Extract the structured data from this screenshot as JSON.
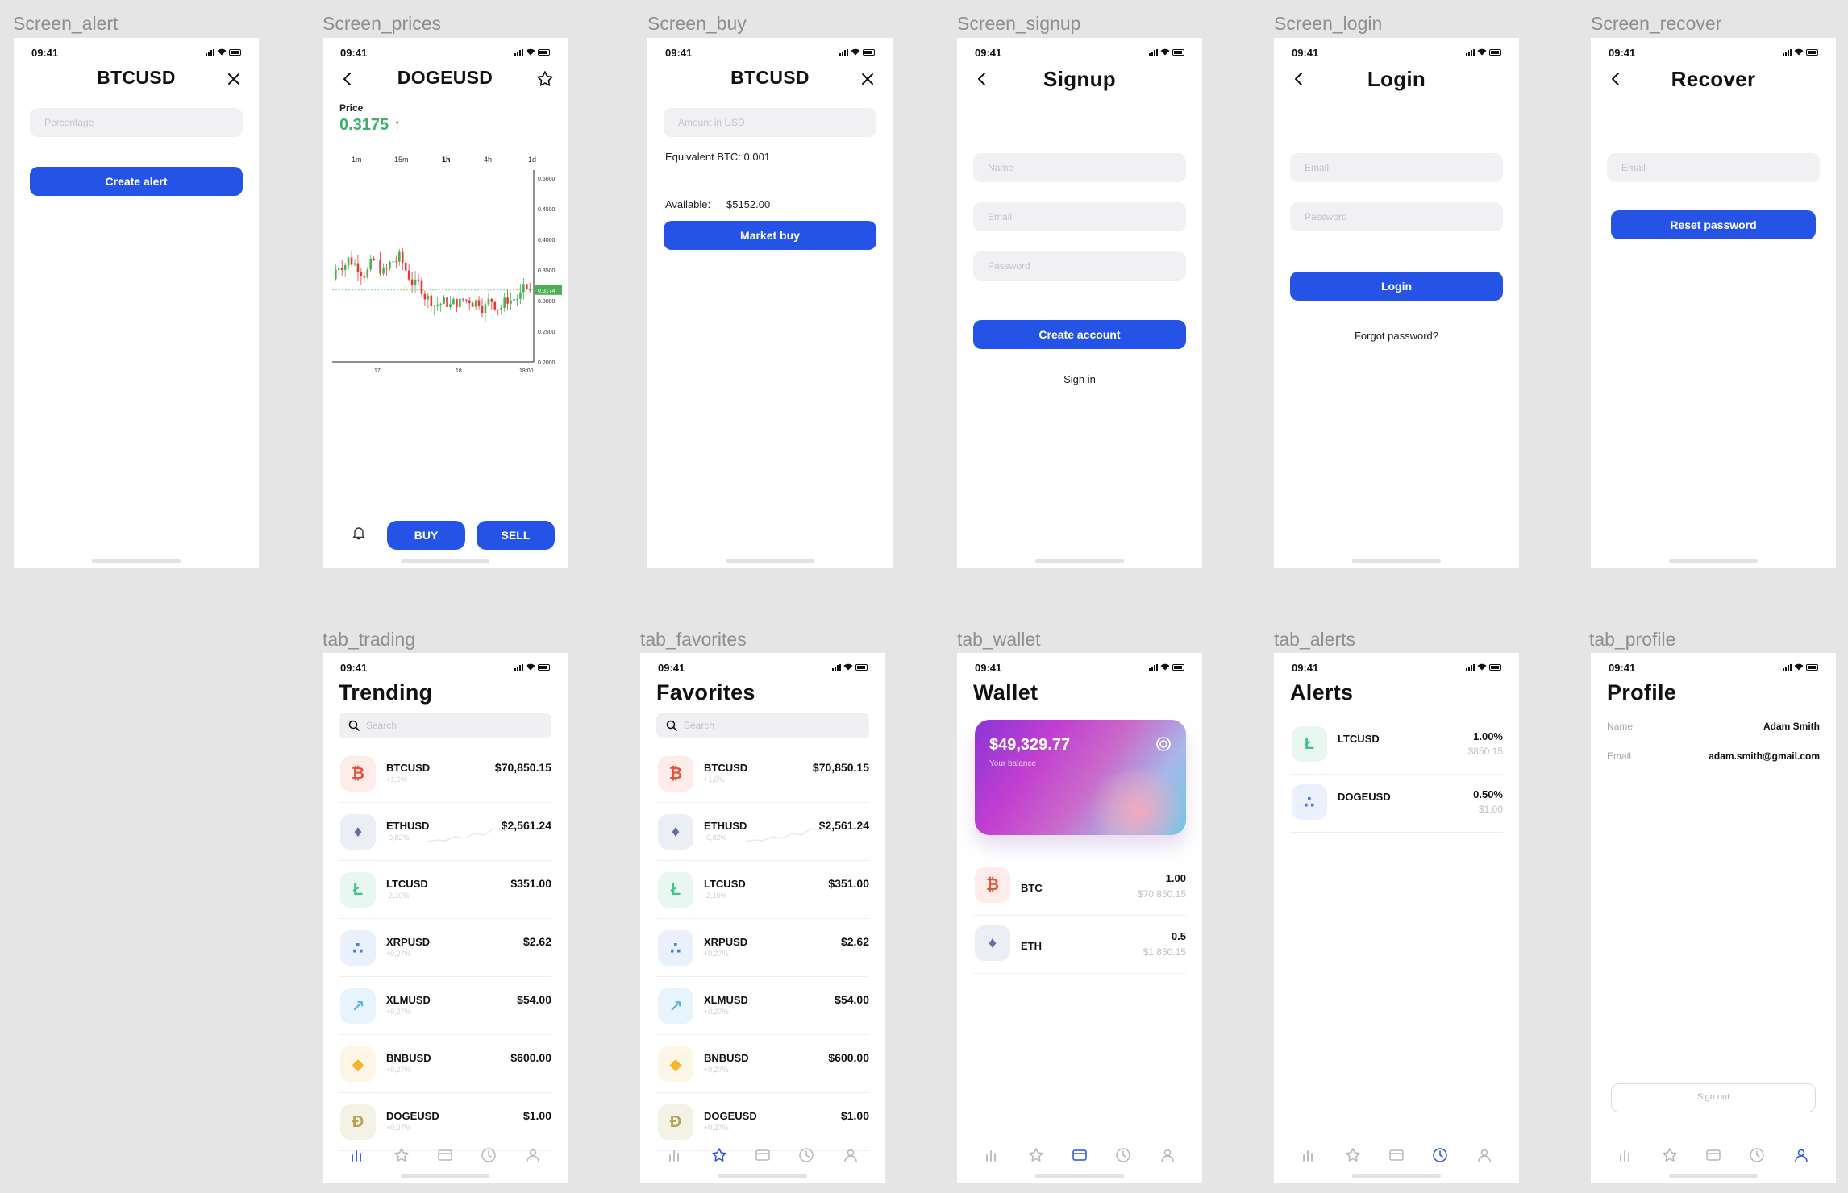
{
  "status_time": "09:41",
  "frame_labels": {
    "alert": "Screen_alert",
    "prices": "Screen_prices",
    "buy": "Screen_buy",
    "signup": "Screen_signup",
    "login": "Screen_login",
    "recover": "Screen_recover",
    "trading": "tab_trading",
    "favorites": "tab_favorites",
    "wallet": "tab_wallet",
    "alerts": "tab_alerts",
    "profile": "tab_profile"
  },
  "alert": {
    "title": "BTCUSD",
    "percentage_placeholder": "Percentage",
    "create_label": "Create alert"
  },
  "prices": {
    "title": "DOGEUSD",
    "price_label": "Price",
    "price_value": "0.3175 ↑",
    "timeframes": [
      "1m",
      "15m",
      "1h",
      "4h",
      "1d"
    ],
    "buy_label": "BUY",
    "sell_label": "SELL",
    "chart": {
      "y_ticks": [
        "0.5000",
        "0.4500",
        "0.4000",
        "0.3500",
        "0.3000",
        "0.2500",
        "0.2000"
      ],
      "x_ticks": [
        "17",
        "18",
        "18:00"
      ],
      "current_tag": "0.3174",
      "up_color": "#4caf50",
      "down_color": "#e53935"
    }
  },
  "buy": {
    "title": "BTCUSD",
    "amount_placeholder": "Amount in USD",
    "equivalent": "Equivalent BTC: 0.001",
    "available_label": "Available:",
    "available_value": "$5152.00",
    "market_buy_label": "Market buy"
  },
  "signup": {
    "title": "Signup",
    "name_placeholder": "Name",
    "email_placeholder": "Email",
    "password_placeholder": "Password",
    "create_label": "Create account",
    "signin_link": "Sign in"
  },
  "login": {
    "title": "Login",
    "email_placeholder": "Email",
    "password_placeholder": "Password",
    "login_label": "Login",
    "forgot_link": "Forgot password?"
  },
  "recover": {
    "title": "Recover",
    "email_placeholder": "Email",
    "reset_label": "Reset password"
  },
  "search_placeholder": "Search",
  "coins": [
    {
      "name": "BTCUSD",
      "change": "+1,6%",
      "price": "$70,850.15",
      "icon": "bitcoin-icon",
      "bg": "#fdece9",
      "fg": "#e0543a"
    },
    {
      "name": "ETHUSD",
      "change": "-0,82%",
      "price": "$2,561.24",
      "icon": "ethereum-icon",
      "bg": "#eceef6",
      "fg": "#5f6fa8"
    },
    {
      "name": "LTCUSD",
      "change": "-2,10%",
      "price": "$351.00",
      "icon": "litecoin-icon",
      "bg": "#e8f8f1",
      "fg": "#3fc48a"
    },
    {
      "name": "XRPUSD",
      "change": "+0,27%",
      "price": "$2.62",
      "icon": "xrp-icon",
      "bg": "#eaf0fc",
      "fg": "#4a78e8"
    },
    {
      "name": "XLMUSD",
      "change": "+0,27%",
      "price": "$54.00",
      "icon": "stellar-icon",
      "bg": "#e8f4fd",
      "fg": "#5cb3ee"
    },
    {
      "name": "BNBUSD",
      "change": "+0,27%",
      "price": "$600.00",
      "icon": "binance-icon",
      "bg": "#fdf6e7",
      "fg": "#f0b72f"
    },
    {
      "name": "DOGEUSD",
      "change": "+0,27%",
      "price": "$1.00",
      "icon": "dogecoin-icon",
      "bg": "#f4f1e6",
      "fg": "#b9a453"
    }
  ],
  "trading": {
    "title": "Trending"
  },
  "favorites": {
    "title": "Favorites"
  },
  "wallet": {
    "title": "Wallet",
    "balance": "$49,329.77",
    "balance_label": "Your balance",
    "assets": [
      {
        "name": "BTC",
        "amount": "1.00",
        "value": "$70,850.15",
        "icon": "bitcoin-icon"
      },
      {
        "name": "ETH",
        "amount": "0.5",
        "value": "$1,850.15",
        "icon": "ethereum-icon"
      }
    ]
  },
  "alerts": {
    "title": "Alerts",
    "items": [
      {
        "name": "LTCUSD",
        "pct": "1.00%",
        "price": "$850.15",
        "icon": "litecoin-icon"
      },
      {
        "name": "DOGEUSD",
        "pct": "0.50%",
        "price": "$1.00",
        "icon": "xrp-icon"
      }
    ]
  },
  "profile": {
    "title": "Profile",
    "name_label": "Name",
    "name_value": "Adam Smith",
    "email_label": "Email",
    "email_value": "adam.smith@gmail.com",
    "signout_label": "Sign out"
  },
  "colors": {
    "accent": "#2553e6",
    "positive": "#3db06a",
    "background": "#e5e5e5"
  }
}
